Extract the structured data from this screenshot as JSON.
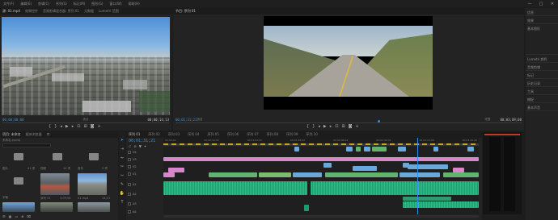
{
  "menu": [
    "文件(F)",
    "编辑(E)",
    "剪辑(C)",
    "序列(S)",
    "标记(M)",
    "图形(G)",
    "窗口(W)",
    "帮助(H)"
  ],
  "source_panel": {
    "tabs": [
      "源: 01.mp4",
      "效果控件",
      "音频剪辑混合器: 序列 01",
      "元数据",
      "Lumetri 范围"
    ],
    "timecode_left": "00;00;00;00",
    "fit_label": "适合",
    "timecode_right": "00;00;14;13"
  },
  "program_panel": {
    "tabs": [
      "节目: 序列 01"
    ],
    "timecode_left": "00;01;31;21",
    "fit_label": "适合",
    "quality": "完整",
    "timecode_right": "00;03;09;08"
  },
  "project_panel": {
    "tabs": [
      "项目: 未命名",
      "媒体浏览器",
      "库"
    ],
    "path": "未命名.prproj",
    "items": [
      {
        "name": "图片",
        "count": "41 项"
      },
      {
        "name": "视频",
        "count": "14 项"
      },
      {
        "name": "音乐",
        "count": "9 项"
      },
      {
        "name": "序列 01",
        "count": "3;09;08"
      },
      {
        "name": "01.mp4",
        "count": "14;13"
      },
      {
        "name": "02.mp4",
        "count": "16;29"
      },
      {
        "name": "字幕",
        "count": "5 项"
      }
    ]
  },
  "timeline": {
    "tabs": [
      "序列 01",
      "序列 02",
      "序列 03",
      "序列 04",
      "序列 05",
      "序列 06",
      "序列 07",
      "序列 08",
      "序列 09",
      "序列 10"
    ],
    "timecode": "00;01;31;21",
    "ruler": [
      "00;00;00",
      "00;00;32;00",
      "00;01;04;02",
      "00;01;36;02",
      "00;02;08;04",
      "00;02;40;04",
      "00;03;12;06",
      "00;03;44;06"
    ],
    "tracks": [
      "V4",
      "V3",
      "V2",
      "V1",
      "A1",
      "A2",
      "A3",
      "A4"
    ]
  },
  "right_panel": {
    "items": [
      "信息",
      "效果",
      "基本图形",
      "Lumetri 颜色",
      "音频剪辑",
      "标记",
      "历史记录",
      "工具",
      "捕捉",
      "基本声音"
    ]
  },
  "colors": {
    "accent": "#2d8ceb",
    "video_clip": "#6aa8d9",
    "pink_clip": "#d886cc",
    "green_clip": "#62b36e",
    "audio_clip": "#1c9a6c"
  }
}
